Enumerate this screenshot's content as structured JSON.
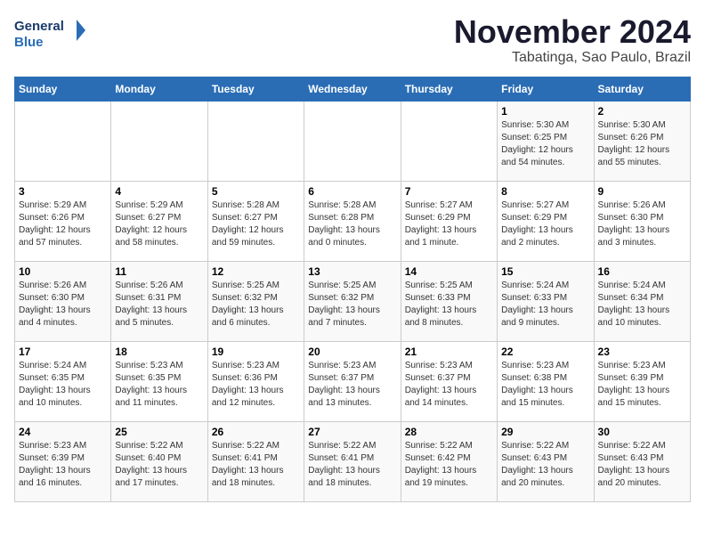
{
  "logo": {
    "line1": "General",
    "line2": "Blue"
  },
  "title": "November 2024",
  "location": "Tabatinga, Sao Paulo, Brazil",
  "weekdays": [
    "Sunday",
    "Monday",
    "Tuesday",
    "Wednesday",
    "Thursday",
    "Friday",
    "Saturday"
  ],
  "weeks": [
    [
      {
        "day": "",
        "info": ""
      },
      {
        "day": "",
        "info": ""
      },
      {
        "day": "",
        "info": ""
      },
      {
        "day": "",
        "info": ""
      },
      {
        "day": "",
        "info": ""
      },
      {
        "day": "1",
        "info": "Sunrise: 5:30 AM\nSunset: 6:25 PM\nDaylight: 12 hours and 54 minutes."
      },
      {
        "day": "2",
        "info": "Sunrise: 5:30 AM\nSunset: 6:26 PM\nDaylight: 12 hours and 55 minutes."
      }
    ],
    [
      {
        "day": "3",
        "info": "Sunrise: 5:29 AM\nSunset: 6:26 PM\nDaylight: 12 hours and 57 minutes."
      },
      {
        "day": "4",
        "info": "Sunrise: 5:29 AM\nSunset: 6:27 PM\nDaylight: 12 hours and 58 minutes."
      },
      {
        "day": "5",
        "info": "Sunrise: 5:28 AM\nSunset: 6:27 PM\nDaylight: 12 hours and 59 minutes."
      },
      {
        "day": "6",
        "info": "Sunrise: 5:28 AM\nSunset: 6:28 PM\nDaylight: 13 hours and 0 minutes."
      },
      {
        "day": "7",
        "info": "Sunrise: 5:27 AM\nSunset: 6:29 PM\nDaylight: 13 hours and 1 minute."
      },
      {
        "day": "8",
        "info": "Sunrise: 5:27 AM\nSunset: 6:29 PM\nDaylight: 13 hours and 2 minutes."
      },
      {
        "day": "9",
        "info": "Sunrise: 5:26 AM\nSunset: 6:30 PM\nDaylight: 13 hours and 3 minutes."
      }
    ],
    [
      {
        "day": "10",
        "info": "Sunrise: 5:26 AM\nSunset: 6:30 PM\nDaylight: 13 hours and 4 minutes."
      },
      {
        "day": "11",
        "info": "Sunrise: 5:26 AM\nSunset: 6:31 PM\nDaylight: 13 hours and 5 minutes."
      },
      {
        "day": "12",
        "info": "Sunrise: 5:25 AM\nSunset: 6:32 PM\nDaylight: 13 hours and 6 minutes."
      },
      {
        "day": "13",
        "info": "Sunrise: 5:25 AM\nSunset: 6:32 PM\nDaylight: 13 hours and 7 minutes."
      },
      {
        "day": "14",
        "info": "Sunrise: 5:25 AM\nSunset: 6:33 PM\nDaylight: 13 hours and 8 minutes."
      },
      {
        "day": "15",
        "info": "Sunrise: 5:24 AM\nSunset: 6:33 PM\nDaylight: 13 hours and 9 minutes."
      },
      {
        "day": "16",
        "info": "Sunrise: 5:24 AM\nSunset: 6:34 PM\nDaylight: 13 hours and 10 minutes."
      }
    ],
    [
      {
        "day": "17",
        "info": "Sunrise: 5:24 AM\nSunset: 6:35 PM\nDaylight: 13 hours and 10 minutes."
      },
      {
        "day": "18",
        "info": "Sunrise: 5:23 AM\nSunset: 6:35 PM\nDaylight: 13 hours and 11 minutes."
      },
      {
        "day": "19",
        "info": "Sunrise: 5:23 AM\nSunset: 6:36 PM\nDaylight: 13 hours and 12 minutes."
      },
      {
        "day": "20",
        "info": "Sunrise: 5:23 AM\nSunset: 6:37 PM\nDaylight: 13 hours and 13 minutes."
      },
      {
        "day": "21",
        "info": "Sunrise: 5:23 AM\nSunset: 6:37 PM\nDaylight: 13 hours and 14 minutes."
      },
      {
        "day": "22",
        "info": "Sunrise: 5:23 AM\nSunset: 6:38 PM\nDaylight: 13 hours and 15 minutes."
      },
      {
        "day": "23",
        "info": "Sunrise: 5:23 AM\nSunset: 6:39 PM\nDaylight: 13 hours and 15 minutes."
      }
    ],
    [
      {
        "day": "24",
        "info": "Sunrise: 5:23 AM\nSunset: 6:39 PM\nDaylight: 13 hours and 16 minutes."
      },
      {
        "day": "25",
        "info": "Sunrise: 5:22 AM\nSunset: 6:40 PM\nDaylight: 13 hours and 17 minutes."
      },
      {
        "day": "26",
        "info": "Sunrise: 5:22 AM\nSunset: 6:41 PM\nDaylight: 13 hours and 18 minutes."
      },
      {
        "day": "27",
        "info": "Sunrise: 5:22 AM\nSunset: 6:41 PM\nDaylight: 13 hours and 18 minutes."
      },
      {
        "day": "28",
        "info": "Sunrise: 5:22 AM\nSunset: 6:42 PM\nDaylight: 13 hours and 19 minutes."
      },
      {
        "day": "29",
        "info": "Sunrise: 5:22 AM\nSunset: 6:43 PM\nDaylight: 13 hours and 20 minutes."
      },
      {
        "day": "30",
        "info": "Sunrise: 5:22 AM\nSunset: 6:43 PM\nDaylight: 13 hours and 20 minutes."
      }
    ]
  ]
}
